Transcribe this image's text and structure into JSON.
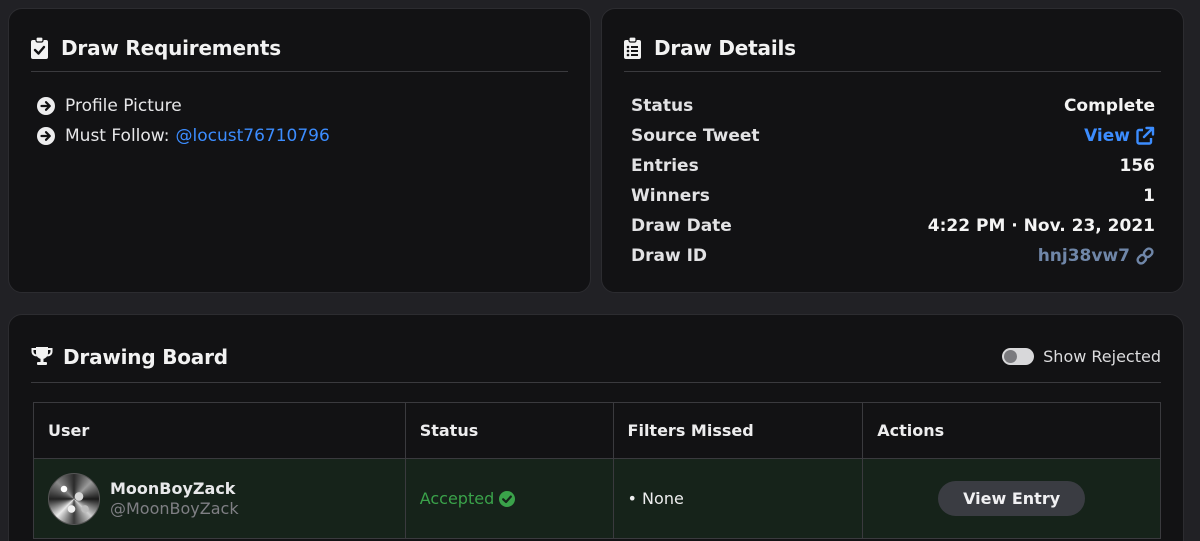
{
  "requirements": {
    "title": "Draw Requirements",
    "items": [
      {
        "label": "Profile Picture",
        "link": ""
      },
      {
        "label": "Must Follow:",
        "link": "@locust76710796"
      }
    ]
  },
  "details": {
    "title": "Draw Details",
    "rows": [
      {
        "label": "Status",
        "value": "Complete"
      },
      {
        "label": "Source Tweet",
        "value": "View"
      },
      {
        "label": "Entries",
        "value": "156"
      },
      {
        "label": "Winners",
        "value": "1"
      },
      {
        "label": "Draw Date",
        "value": "4:22 PM · Nov. 23, 2021"
      },
      {
        "label": "Draw ID",
        "value": "hnj38vw7"
      }
    ]
  },
  "board": {
    "title": "Drawing Board",
    "toggle_label": "Show Rejected",
    "toggle_on": false,
    "columns": [
      "User",
      "Status",
      "Filters Missed",
      "Actions"
    ],
    "rows": [
      {
        "name": "MoonBoyZack",
        "handle": "@MoonBoyZack",
        "status": "Accepted",
        "filters_missed": "• None",
        "action": "View Entry"
      }
    ]
  },
  "colors": {
    "background": "#212125",
    "card": "#121214",
    "link_blue": "#3c8dff",
    "accepted_green": "#3aa24a",
    "accepted_row": "#16231a"
  },
  "icons": {
    "requirements": "clipboard-check-icon",
    "details": "clipboard-list-icon",
    "board": "trophy-icon",
    "list_bullet": "arrow-circle-right-icon",
    "source_link": "external-link-icon",
    "id_link": "link-icon",
    "status_ok": "check-circle-icon"
  }
}
